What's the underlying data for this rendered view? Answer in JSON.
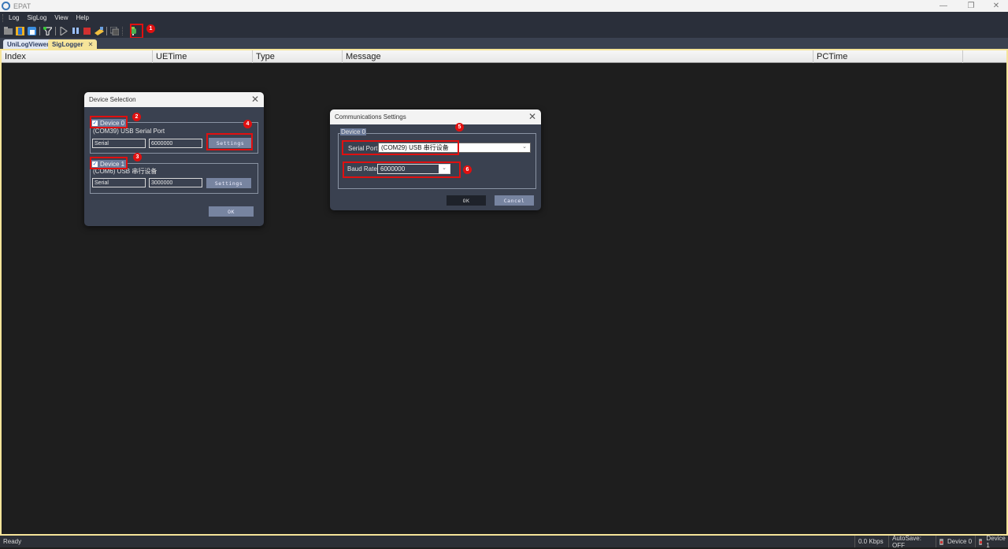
{
  "window": {
    "title": "EPAT",
    "controls": {
      "minimize": "—",
      "restore": "❐",
      "close": "✕"
    }
  },
  "menubar": {
    "items": [
      "Log",
      "SigLog",
      "View",
      "Help"
    ]
  },
  "toolbar": {
    "icons": [
      "open-folder-icon",
      "save-icon",
      "export-icon",
      "filter-icon",
      "play-icon",
      "pause-icon",
      "stop-icon",
      "clear-icon",
      "copy-icon",
      "device-connect-icon"
    ]
  },
  "tabs": [
    {
      "label": "UniLogViewer",
      "active": false
    },
    {
      "label": "SigLogger",
      "active": true,
      "close": "✕"
    }
  ],
  "grid": {
    "columns": [
      "Index",
      "UETime",
      "Type",
      "Message",
      "PCTime",
      ""
    ]
  },
  "annotations": [
    "1",
    "2",
    "3",
    "4",
    "5",
    "6"
  ],
  "device_selection": {
    "title": "Device Selection",
    "close": "✕",
    "devices": [
      {
        "label": "Device 0",
        "checked": true,
        "check": "✓",
        "port_desc": "(COM39) USB Serial Port",
        "type": "Serial",
        "baud": "6000000",
        "settings_label": "Settings"
      },
      {
        "label": "Device 1",
        "checked": true,
        "check": "✓",
        "port_desc": "(COM6) USB 串行设备",
        "type": "Serial",
        "baud": "3000000",
        "settings_label": "Settings"
      }
    ],
    "ok_label": "OK"
  },
  "comm_settings": {
    "title": "Communications Settings",
    "close": "✕",
    "group_label": "Device 0",
    "serial_port_label": "Serial Port",
    "serial_port_value": "(COM29) USB 串行设备",
    "baud_rate_label": "Baud Rate",
    "baud_rate_value": "6000000",
    "chevron": "⌄",
    "ok_label": "OK",
    "cancel_label": "Cancel"
  },
  "statusbar": {
    "status": "Ready",
    "rate": "0.0 Kbps",
    "autosave": "AutoSave: OFF",
    "device0": "Device 0",
    "device1": "Device 1"
  }
}
